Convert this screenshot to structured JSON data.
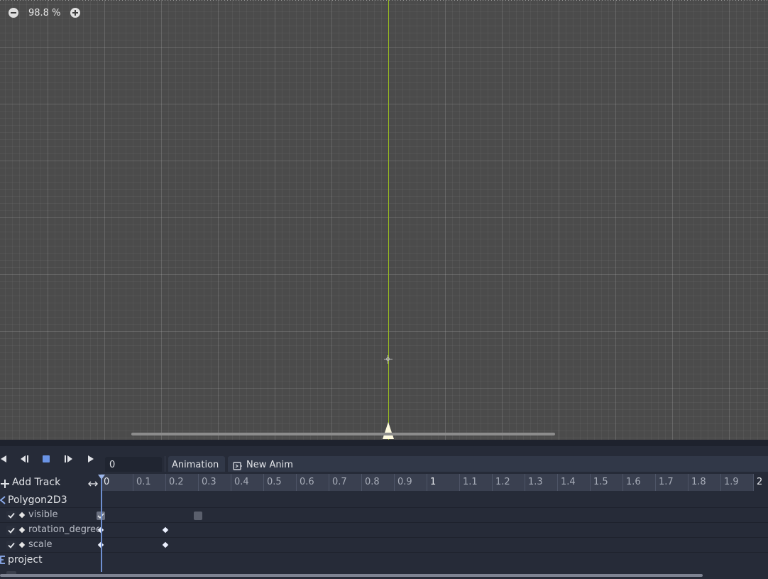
{
  "canvas": {
    "zoom_label": "98.8 %"
  },
  "toolbar": {
    "time_value": "0",
    "animation_button": "Animation",
    "animation_name": "New Anim"
  },
  "timeline": {
    "add_track_label": "Add Track",
    "ruler_labels": [
      "0",
      "0.1",
      "0.2",
      "0.3",
      "0.4",
      "0.5",
      "0.6",
      "0.7",
      "0.8",
      "0.9",
      "1",
      "1.1",
      "1.2",
      "1.3",
      "1.4",
      "1.5",
      "1.6",
      "1.7",
      "1.8",
      "1.9",
      "2"
    ]
  },
  "tracks": {
    "node_1": "Polygon2D3",
    "prop_visible": "visible",
    "prop_rotation": "rotation_degrees",
    "prop_scale": "scale",
    "node_2": "project"
  },
  "colors": {
    "y_axis": "#9bc01c",
    "accent": "#6e8fd0",
    "panel_bg": "#262b38"
  }
}
